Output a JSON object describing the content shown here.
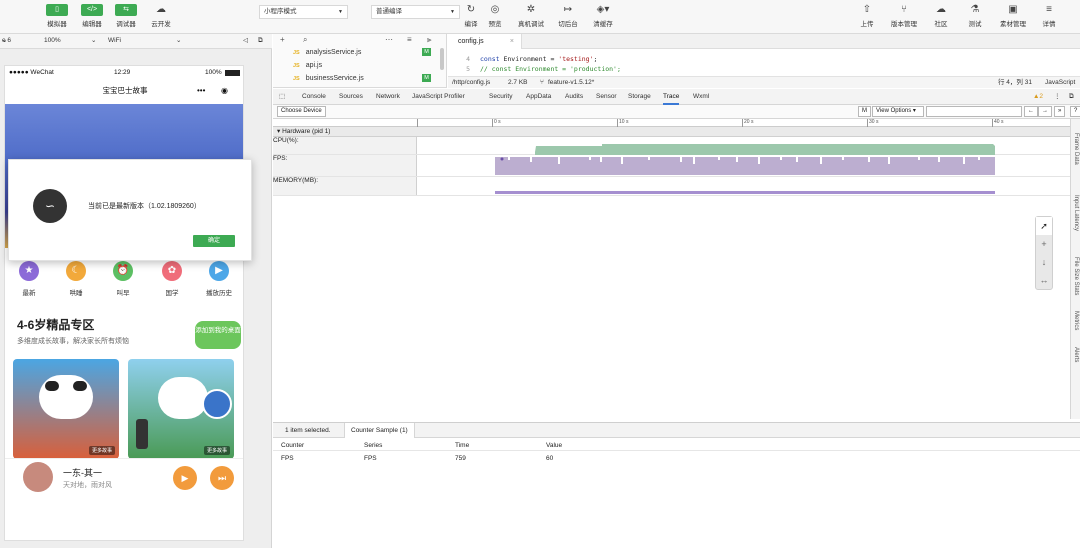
{
  "toolbar": {
    "left_buttons": [
      {
        "label": "模拟器",
        "icon": "phone-icon"
      },
      {
        "label": "编辑器",
        "icon": "code-icon"
      },
      {
        "label": "调试器",
        "icon": "debug-icon"
      },
      {
        "label": "云开发",
        "icon": "cloud-icon"
      }
    ],
    "mode_select": "小程序模式",
    "compile_select": "普通编译",
    "mid_buttons": [
      {
        "label": "编译",
        "icon": "refresh-icon"
      },
      {
        "label": "预览",
        "icon": "eye-icon"
      },
      {
        "label": "真机调试",
        "icon": "bug-icon"
      },
      {
        "label": "切后台",
        "icon": "switch-icon"
      },
      {
        "label": "清缓存",
        "icon": "layers-icon"
      }
    ],
    "right_buttons": [
      {
        "label": "上传",
        "icon": "upload-icon"
      },
      {
        "label": "版本管理",
        "icon": "branch-icon"
      },
      {
        "label": "社区",
        "icon": "chat-icon"
      },
      {
        "label": "测试",
        "icon": "flask-icon"
      },
      {
        "label": "素材管理",
        "icon": "folder-icon"
      },
      {
        "label": "详情",
        "icon": "menu-icon"
      }
    ]
  },
  "device_bar": {
    "device": "e 6 Plus",
    "zoom": "100%",
    "network": "WiFi"
  },
  "simulator": {
    "status": {
      "carrier": "●●●●● WeChat",
      "time": "12:29",
      "battery": "100%"
    },
    "nav_title": "宝宝巴士故事",
    "capsule_more": "•••",
    "capsule_close": "◉",
    "dialog": {
      "message": "当前已是最新版本（1.02.1809260）",
      "ok": "确定"
    },
    "categories": [
      {
        "label": "最新",
        "color": "#8c6ad8"
      },
      {
        "label": "哄睡",
        "color": "#f2a93b"
      },
      {
        "label": "叫早",
        "color": "#5cbf63"
      },
      {
        "label": "国学",
        "color": "#f06d7a"
      },
      {
        "label": "播放历史",
        "color": "#4da7e8"
      }
    ],
    "section_title": "4-6岁精品专区",
    "section_sub": "多维度成长故事，解决家长所有烦恼",
    "float_badge": "添加到我的桌面",
    "card_tag": "更多故事",
    "player": {
      "title": "一东-其一",
      "subtitle": "天对地，雨对风"
    }
  },
  "filetree": {
    "files": [
      {
        "name": "analysisService.js",
        "badge": "M"
      },
      {
        "name": "api.js",
        "badge": ""
      },
      {
        "name": "businessService.js",
        "badge": "M"
      }
    ]
  },
  "editor": {
    "tab": "config.js",
    "lines": [
      {
        "no": "4",
        "pre": "const ",
        "mid": "Environment = ",
        "str": "'testing'",
        "post": ";"
      },
      {
        "no": "5",
        "comment": "// const Environment = 'production';"
      }
    ],
    "status": {
      "path": "/http/config.js",
      "size": "2.7 KB",
      "branch": "feature-v1.5.12*",
      "cursor": "行 4，列 31",
      "lang": "JavaScript"
    }
  },
  "devtools": {
    "tabs": [
      "Console",
      "Sources",
      "Network",
      "JavaScript Profiler",
      "Security",
      "AppData",
      "Audits",
      "Sensor",
      "Storage",
      "Trace",
      "Wxml"
    ],
    "active_tab": "Trace",
    "warnings": "▲2",
    "choose_device": "Choose Device",
    "m_btn": "M",
    "view_options": "View Options",
    "ruler_labels": [
      "0 s",
      "10 s",
      "20 s",
      "30 s",
      "40 s"
    ],
    "hardware_header": "▾ Hardware (pid 1)",
    "tracks": [
      "CPU(%):",
      "FPS:",
      "MEMORY(MB):"
    ],
    "side_tabs": [
      "Frame Data",
      "Input Latency",
      "File Size Stats",
      "Metrics",
      "Alerts"
    ],
    "details": {
      "tabs": [
        "1 item selected.",
        "Counter Sample (1)"
      ],
      "columns": [
        "Counter",
        "Series",
        "Time",
        "Value"
      ],
      "row": [
        "FPS",
        "FPS",
        "759",
        "60"
      ]
    }
  },
  "colors": {
    "accent_green": "#3daa53",
    "cpu": "#8fbfa2",
    "fps": "#b8a8c8",
    "memory": "#a58fd0"
  }
}
